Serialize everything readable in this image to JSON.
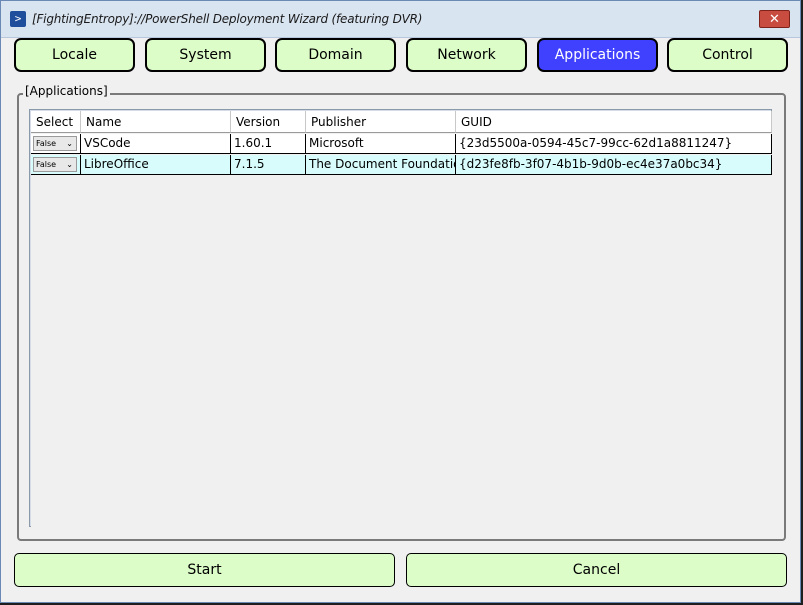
{
  "window": {
    "title": "[FightingEntropy]://PowerShell Deployment Wizard (featuring DVR)",
    "close_glyph": "✕"
  },
  "tabs": [
    {
      "label": "Locale",
      "active": false
    },
    {
      "label": "System",
      "active": false
    },
    {
      "label": "Domain",
      "active": false
    },
    {
      "label": "Network",
      "active": false
    },
    {
      "label": "Applications",
      "active": true
    },
    {
      "label": "Control",
      "active": false
    }
  ],
  "applications": {
    "group_label": "[Applications]",
    "columns": [
      "Select",
      "Name",
      "Version",
      "Publisher",
      "GUID"
    ],
    "rows": [
      {
        "select": "False",
        "name": "VSCode",
        "version": "1.60.1",
        "publisher": "Microsoft",
        "guid": "{23d5500a-0594-45c7-99cc-62d1a8811247}"
      },
      {
        "select": "False",
        "name": "LibreOffice",
        "version": "7.1.5",
        "publisher": "The Document Foundatior",
        "guid": "{d23fe8fb-3f07-4b1b-9d0b-ec4e37a0bc34}"
      }
    ]
  },
  "footer": {
    "start_label": "Start",
    "cancel_label": "Cancel"
  },
  "colors": {
    "tab_bg": "#dcfcc8",
    "tab_active_bg": "#4040ff",
    "row_alt_bg": "#d8fcfc"
  }
}
